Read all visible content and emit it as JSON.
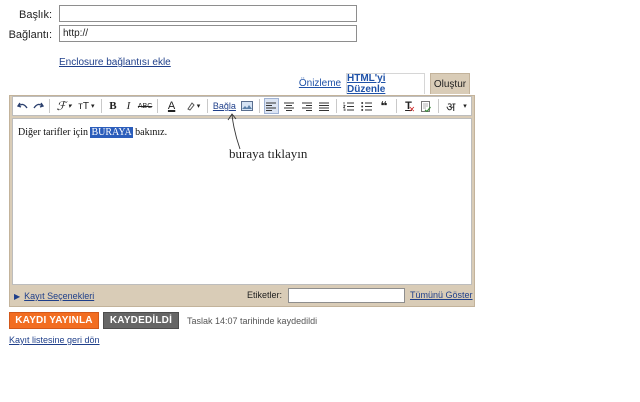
{
  "form": {
    "title_label": "Başlık:",
    "title_value": "",
    "link_label": "Bağlantı:",
    "link_value": "http://",
    "enclosure_link": "Enclosure bağlantısı ekle"
  },
  "tabs": [
    {
      "label": "Önizleme"
    },
    {
      "label": "HTML'yi Düzenle"
    },
    {
      "label": "Oluştur"
    }
  ],
  "toolbar": {
    "link_label": "Bağla",
    "font_glyph": "ℱ",
    "size_glyph": "тT",
    "bold": "B",
    "italic": "I",
    "strike": "ABC",
    "text_color": "A",
    "quote": "❝",
    "clear": "T",
    "hindi": "अ"
  },
  "editor": {
    "text_before": "Diğer tarifler için ",
    "text_selected": "BURAYA",
    "text_after": " bakınız."
  },
  "annotation": {
    "text": "buraya tıklayın"
  },
  "bottom": {
    "post_options": "Kayıt Seçenekleri",
    "labels_label": "Etiketler:",
    "labels_value": "",
    "show_all": "Tümünü Göster"
  },
  "actions": {
    "publish": "KAYDI YAYINLA",
    "saved": "KAYDEDİLDİ",
    "draft_status": "Taslak 14:07 tarihinde kaydedildi",
    "back_link": "Kayıt listesine geri dön"
  },
  "colors": {
    "accent_orange": "#f26d21",
    "frame_tan": "#d9ccb7",
    "selection_blue": "#2b5dbb",
    "link_blue": "#1f3f8a"
  }
}
